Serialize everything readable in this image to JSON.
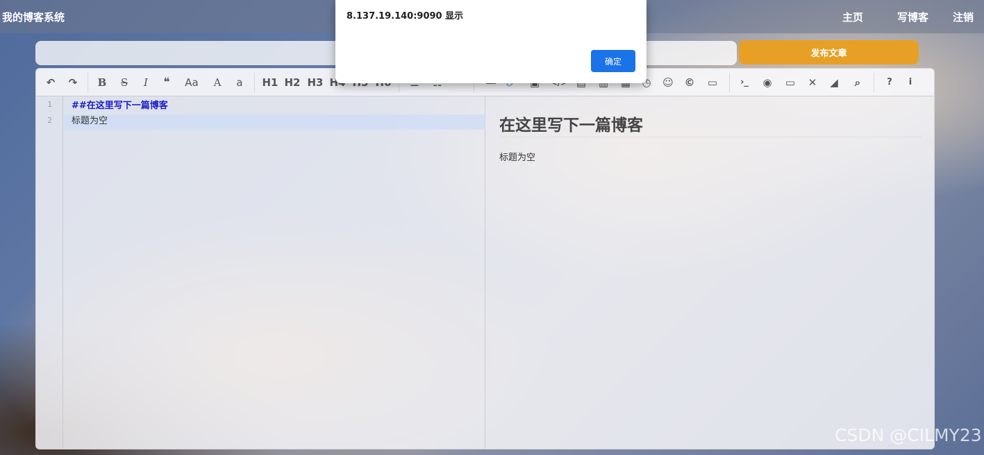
{
  "navbar": {
    "brand": "我的博客系统",
    "links": [
      "主页",
      "写博客",
      "注销"
    ]
  },
  "title_input": {
    "value": ""
  },
  "publish_button": "发布文章",
  "toolbar": {
    "undo": "↶",
    "redo": "↷",
    "bold": "B",
    "strike": "S",
    "italic": "I",
    "quote": "❝",
    "upper": "Aa",
    "ucfirst": "A",
    "lower": "a",
    "h1": "H1",
    "h2": "H2",
    "h3": "H3",
    "h4": "H4",
    "h5": "H5",
    "h6": "H6",
    "list_ul": "☰",
    "list_ol": "☷",
    "hr": "—",
    "link": "🔗",
    "anchor": "⚓",
    "image": "▣",
    "code_inline": "</>",
    "code_block": "▤",
    "pre": "▥",
    "table": "▦",
    "datetime": "◷",
    "emoji": "☺",
    "html_entities": "©",
    "pagebreak": "▭",
    "terminal": "›_",
    "watch": "◉",
    "preview": "▭",
    "fullscreen": "✕",
    "clear": "◢",
    "search": "⌕",
    "help": "?",
    "info": "i"
  },
  "editor": {
    "line_numbers": [
      "1",
      "2"
    ],
    "lines": [
      "##在这里写下一篇博客",
      "标题为空"
    ]
  },
  "preview": {
    "heading": "在这里写下一篇博客",
    "paragraph": "标题为空"
  },
  "dialog": {
    "title": "8.137.19.140:9090 显示",
    "ok_label": "确定"
  },
  "watermark": "CSDN @CILMY23"
}
